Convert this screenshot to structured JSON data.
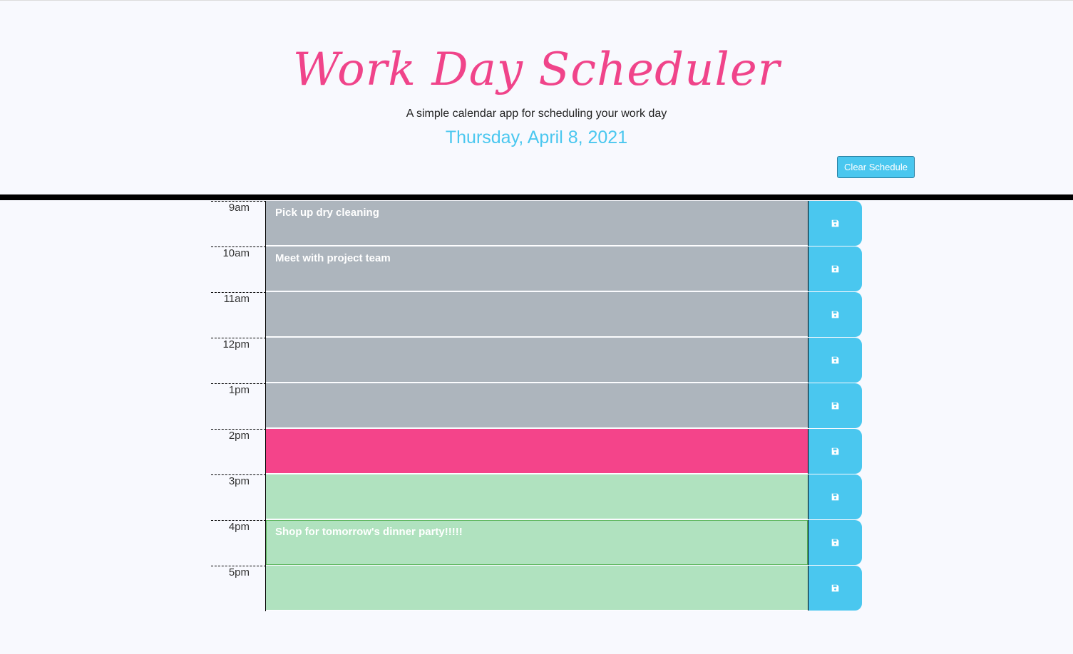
{
  "header": {
    "title": "Work Day Scheduler",
    "subtitle": "A simple calendar app for scheduling your work day",
    "current_day": "Thursday, April 8, 2021",
    "clear_label": "Clear Schedule"
  },
  "colors": {
    "title": "#f0448a",
    "date": "#4ac7ef",
    "past": "#adb5bd",
    "present": "#f4448a",
    "future": "#b0e2bf",
    "save_button": "#4ac7ef"
  },
  "blocks": [
    {
      "hour": "9am",
      "text": "Pick up dry cleaning",
      "state": "past",
      "icon": "save-icon"
    },
    {
      "hour": "10am",
      "text": "Meet with project team",
      "state": "past",
      "icon": "save-icon"
    },
    {
      "hour": "11am",
      "text": "",
      "state": "past",
      "icon": "save-icon"
    },
    {
      "hour": "12pm",
      "text": "",
      "state": "past",
      "icon": "save-icon"
    },
    {
      "hour": "1pm",
      "text": "",
      "state": "past",
      "icon": "save-icon"
    },
    {
      "hour": "2pm",
      "text": "",
      "state": "present",
      "icon": "save-icon"
    },
    {
      "hour": "3pm",
      "text": "",
      "state": "future",
      "icon": "save-icon"
    },
    {
      "hour": "4pm",
      "text": "Shop for tomorrow's dinner party!!!!!",
      "state": "future",
      "icon": "save-icon"
    },
    {
      "hour": "5pm",
      "text": "",
      "state": "future",
      "icon": "save-icon"
    }
  ]
}
